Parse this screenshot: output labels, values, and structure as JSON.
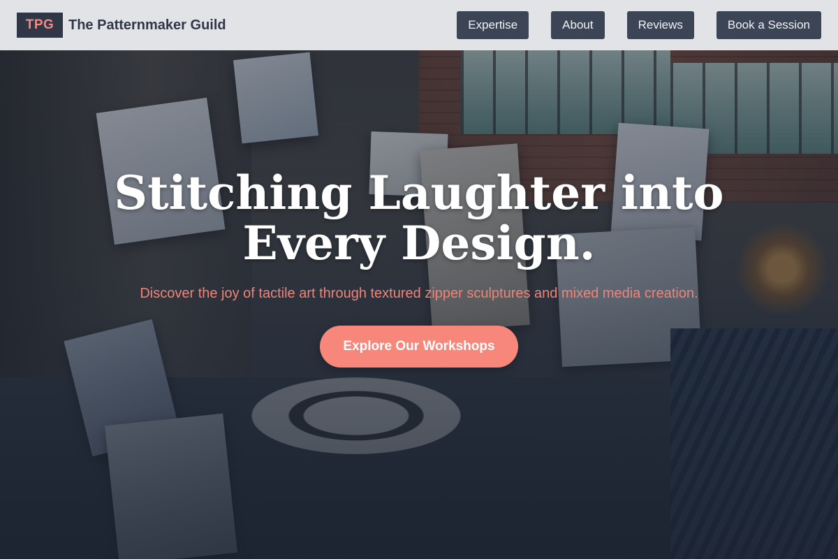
{
  "header": {
    "logo_text": "TPG",
    "site_name": "The Patternmaker Guild",
    "nav": [
      {
        "label": "Expertise"
      },
      {
        "label": "About"
      },
      {
        "label": "Reviews"
      },
      {
        "label": "Book a Session"
      }
    ]
  },
  "hero": {
    "title": "Stitching Laughter into Every Design.",
    "subtitle": "Discover the joy of tactile art through textured zipper sculptures and mixed media creation.",
    "cta_label": "Explore Our Workshops"
  },
  "colors": {
    "header_bg": "#ecedef",
    "nav_button_bg": "#3b4556",
    "brand_dark": "#2f3747",
    "accent": "#f7877b"
  }
}
